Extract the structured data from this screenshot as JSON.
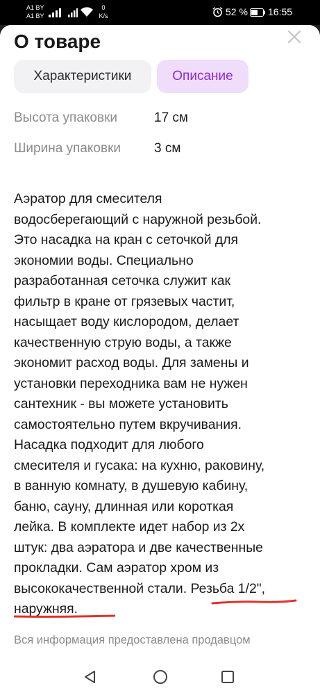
{
  "status_bar": {
    "carrier_1": "A1 BY",
    "carrier_2": "A1 BY",
    "net_speed_value": "0",
    "net_speed_unit": "K/s",
    "battery_percent": "52 %",
    "time": "16:55"
  },
  "sheet": {
    "title": "О товаре",
    "tabs": [
      {
        "label": "Характеристики",
        "active": false
      },
      {
        "label": "Описание",
        "active": true
      }
    ],
    "specs": [
      {
        "label": "Высота упаковки",
        "value": "17 см"
      },
      {
        "label": "Ширина упаковки",
        "value": "3 см"
      }
    ],
    "description_lines": [
      "Аэратор для смесителя",
      "водосберегающий с наружной резьбой.",
      "Это насадка на кран с сеточкой для",
      "экономии воды. Специально",
      "разработанная сеточка служит как",
      "фильтр в кране от грязевых частит,",
      "насыщает воду кислородом, делает",
      "качественную струю воды, а также",
      "экономит расход воды. Для замены и",
      "установки переходника вам не нужен",
      "сантехник - вы можете установить",
      "самостоятельно путем вкручивания.",
      "Насадка подходит для любого",
      "смесителя и гусака: на кухню, раковину,",
      "в ванную комнату, в душевую кабину,",
      "баню, сауну, длинная или короткая",
      "лейка. В комплекте идет набор из 2х",
      "штук: два аэратора и две качественные",
      "прокладки. Сам аэратор хром из",
      "высококачественной стали. Резьба 1/2\",",
      "наружняя."
    ],
    "disclaimer": "Вся информация предоставлена продавцом"
  },
  "colors": {
    "accent": "#8f2ad9",
    "accent_bg": "#f0dcfb",
    "annotation_red": "#e0322a",
    "muted_text": "#8a8a8f"
  },
  "icons": {
    "close": "close-icon",
    "nav_back": "back-triangle-icon",
    "nav_home": "home-circle-icon",
    "nav_recent": "recent-square-icon"
  }
}
